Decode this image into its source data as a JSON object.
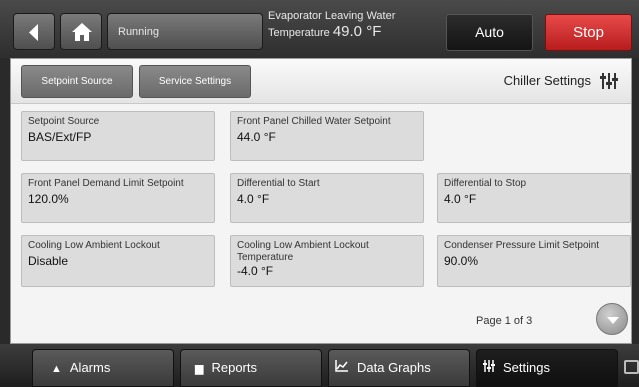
{
  "header": {
    "status": "Running",
    "evaporator_label": "Evaporator Leaving Water",
    "temperature_label": "Temperature",
    "temperature_value": "49.0 °F",
    "auto_label": "Auto",
    "stop_label": "Stop"
  },
  "tabs": {
    "setpoint_source": "Setpoint Source",
    "service_settings": "Service Settings"
  },
  "panel_title": "Chiller Settings",
  "settings": [
    {
      "label": "Setpoint Source",
      "value": "BAS/Ext/FP"
    },
    {
      "label": "Front Panel Chilled Water Setpoint",
      "value": "44.0 °F"
    },
    {
      "label": "Front Panel Demand Limit Setpoint",
      "value": "120.0%"
    },
    {
      "label": "Differential to Start",
      "value": "4.0 °F"
    },
    {
      "label": "Differential to Stop",
      "value": "4.0 °F"
    },
    {
      "label": "Cooling Low Ambient Lockout",
      "value": "Disable"
    },
    {
      "label": "Cooling Low Ambient Lockout Temperature",
      "value": "-4.0 °F"
    },
    {
      "label": "Condenser Pressure Limit Setpoint",
      "value": "90.0%"
    }
  ],
  "page_indicator": "Page 1 of 3",
  "nav": {
    "alarms": "Alarms",
    "reports": "Reports",
    "data_graphs": "Data Graphs",
    "settings": "Settings"
  },
  "icons": [
    "back-arrow-icon",
    "home-icon",
    "sliders-icon",
    "chevron-down-icon",
    "alarm-bell-icon",
    "report-doc-icon",
    "graph-icon",
    "settings-sliders-icon",
    "chat-icon"
  ],
  "colors": {
    "stop": "#d22a2a",
    "auto": "#1a1a1a",
    "panel": "#f4f4f4",
    "tile": "#dcdcdc"
  }
}
